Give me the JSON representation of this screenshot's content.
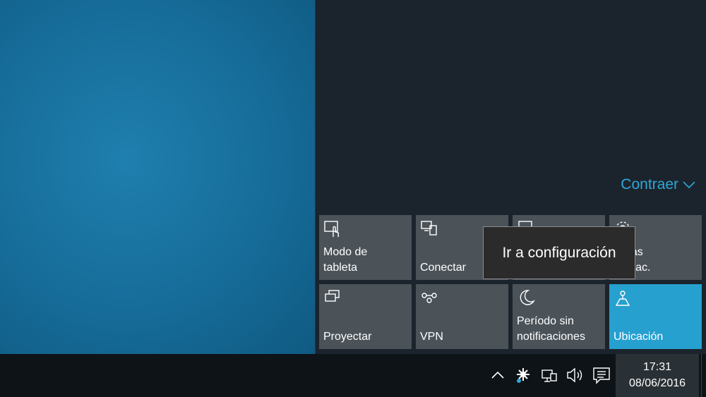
{
  "action_center": {
    "collapse_label": "Contraer",
    "tiles": [
      {
        "label": "Modo de\ntableta",
        "icon": "tablet-mode-icon",
        "active": false
      },
      {
        "label": "Conectar",
        "icon": "connect-icon",
        "active": false
      },
      {
        "label": "",
        "icon": "note-icon",
        "active": false
      },
      {
        "label": "as las\nfigurac.",
        "icon": "gear-icon",
        "active": false
      },
      {
        "label": "Proyectar",
        "icon": "project-icon",
        "active": false
      },
      {
        "label": "VPN",
        "icon": "vpn-icon",
        "active": false
      },
      {
        "label": "Período sin\nnotificaciones",
        "icon": "moon-icon",
        "active": false
      },
      {
        "label": "Ubicación",
        "icon": "location-icon",
        "active": true
      }
    ],
    "tooltip": "Ir a configuración"
  },
  "taskbar": {
    "time": "17:31",
    "date": "08/06/2016",
    "tray_icons": [
      "chevron-up-icon",
      "network-activity-icon",
      "network-icon",
      "volume-icon",
      "action-center-icon"
    ]
  },
  "colors": {
    "accent": "#26a0cf",
    "link": "#2fa7d9",
    "tile": "#4b5359"
  }
}
